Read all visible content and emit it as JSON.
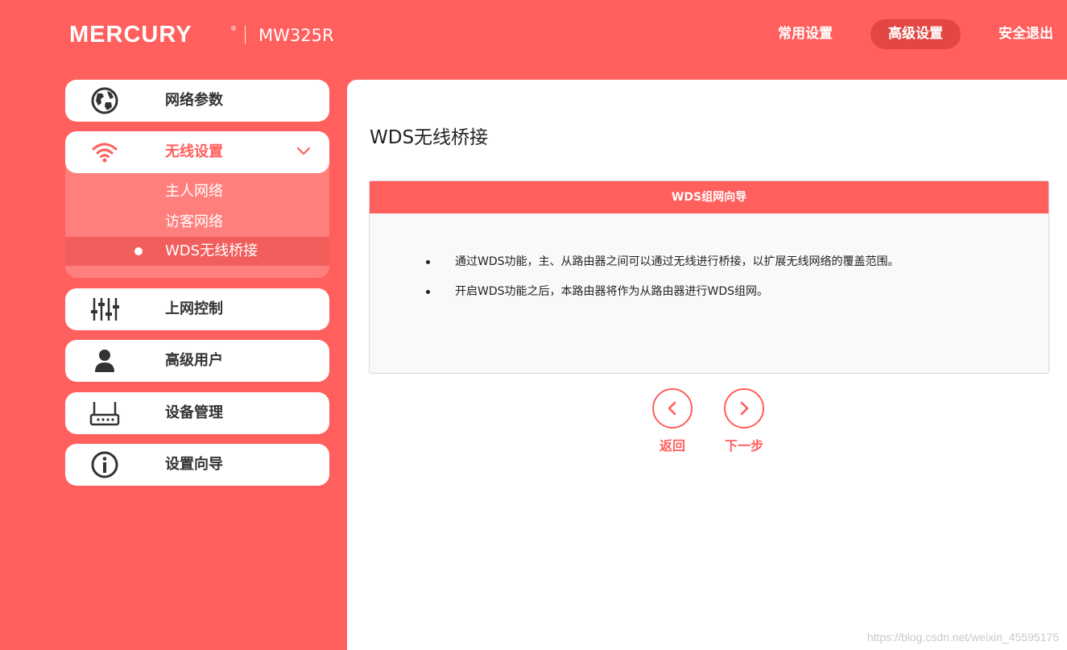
{
  "brand": {
    "logo": "MERCURY",
    "reg_mark": "®",
    "model": "MW325R"
  },
  "topnav": {
    "common": "常用设置",
    "advanced": "高级设置",
    "logout": "安全退出"
  },
  "sidebar": {
    "items": [
      {
        "label": "网络参数",
        "icon": "globe-icon"
      },
      {
        "label": "无线设置",
        "icon": "wifi-icon"
      },
      {
        "label": "上网控制",
        "icon": "sliders-icon"
      },
      {
        "label": "高级用户",
        "icon": "user-icon"
      },
      {
        "label": "设备管理",
        "icon": "router-icon"
      },
      {
        "label": "设置向导",
        "icon": "info-icon"
      }
    ],
    "wireless_sub": [
      {
        "label": "主人网络"
      },
      {
        "label": "访客网络"
      },
      {
        "label": "WDS无线桥接"
      }
    ]
  },
  "main": {
    "title": "WDS无线桥接",
    "panel": {
      "header": "WDS组网向导",
      "bullets": [
        "通过WDS功能，主、从路由器之间可以通过无线进行桥接，以扩展无线网络的覆盖范围。",
        "开启WDS功能之后，本路由器将作为从路由器进行WDS组网。"
      ]
    },
    "back_label": "返回",
    "next_label": "下一步"
  },
  "watermark": "https://blog.csdn.net/weixin_45595175",
  "colors": {
    "accent": "#ff5f5d",
    "accent_dark": "#e24744",
    "submenu_bg": "#ff7f7c"
  }
}
